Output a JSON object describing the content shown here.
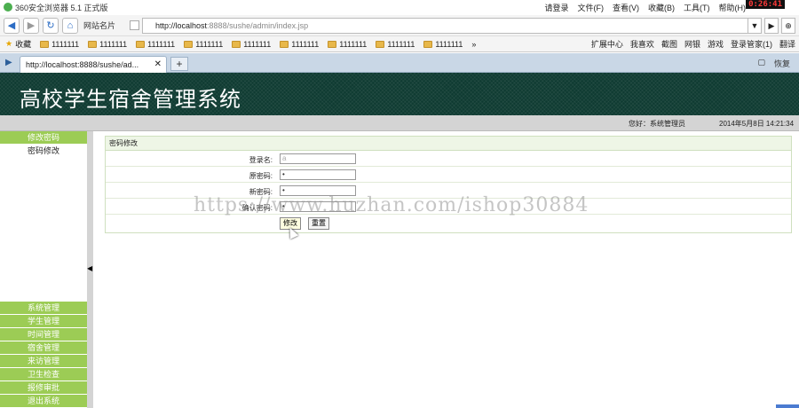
{
  "browser": {
    "title": "360安全浏览器 5.1 正式版",
    "clock": "0:26:41",
    "menu": [
      "请登录",
      "文件(F)",
      "查看(V)",
      "收藏(B)",
      "工具(T)",
      "帮助(H)"
    ],
    "tag_label": "网站名片",
    "url_host": "http://localhost",
    "url_path": ":8888/sushe/admin/index.jsp",
    "favorites_label": "收藏",
    "favorites": [
      "1111111",
      "1111111",
      "1111111",
      "1111111",
      "1111111",
      "1111111",
      "1111111",
      "1111111",
      "1111111"
    ],
    "favorites_more": "»",
    "favbar_right": [
      "扩展中心",
      "我喜欢",
      "截图",
      "网银",
      "游戏",
      "登录管家(1)",
      "翻译"
    ],
    "tab_title": "http://localhost:8888/sushe/ad...",
    "tabbar_right": [
      "恢复"
    ]
  },
  "page": {
    "system_title": "高校学生宿舍管理系统",
    "user_info": "您好：系统管理员",
    "datetime": "2014年5月8日  14:21:34",
    "sidebar": {
      "active_group": "修改密码",
      "active_item": "密码修改",
      "groups": [
        "系统管理",
        "学生管理",
        "时间管理",
        "宿舍管理",
        "来访管理",
        "卫生检查",
        "报修审批",
        "退出系统"
      ]
    },
    "form": {
      "title": "密码修改",
      "username_label": "登录名:",
      "username_value": "a",
      "old_pwd_label": "原密码:",
      "old_pwd_value": "•",
      "new_pwd_label": "新密码:",
      "new_pwd_value": "•",
      "confirm_pwd_label": "确认密码:",
      "confirm_pwd_value": "•",
      "submit_label": "修改",
      "reset_label": "重置"
    },
    "watermark": "https://www.huzhan.com/ishop30884"
  }
}
